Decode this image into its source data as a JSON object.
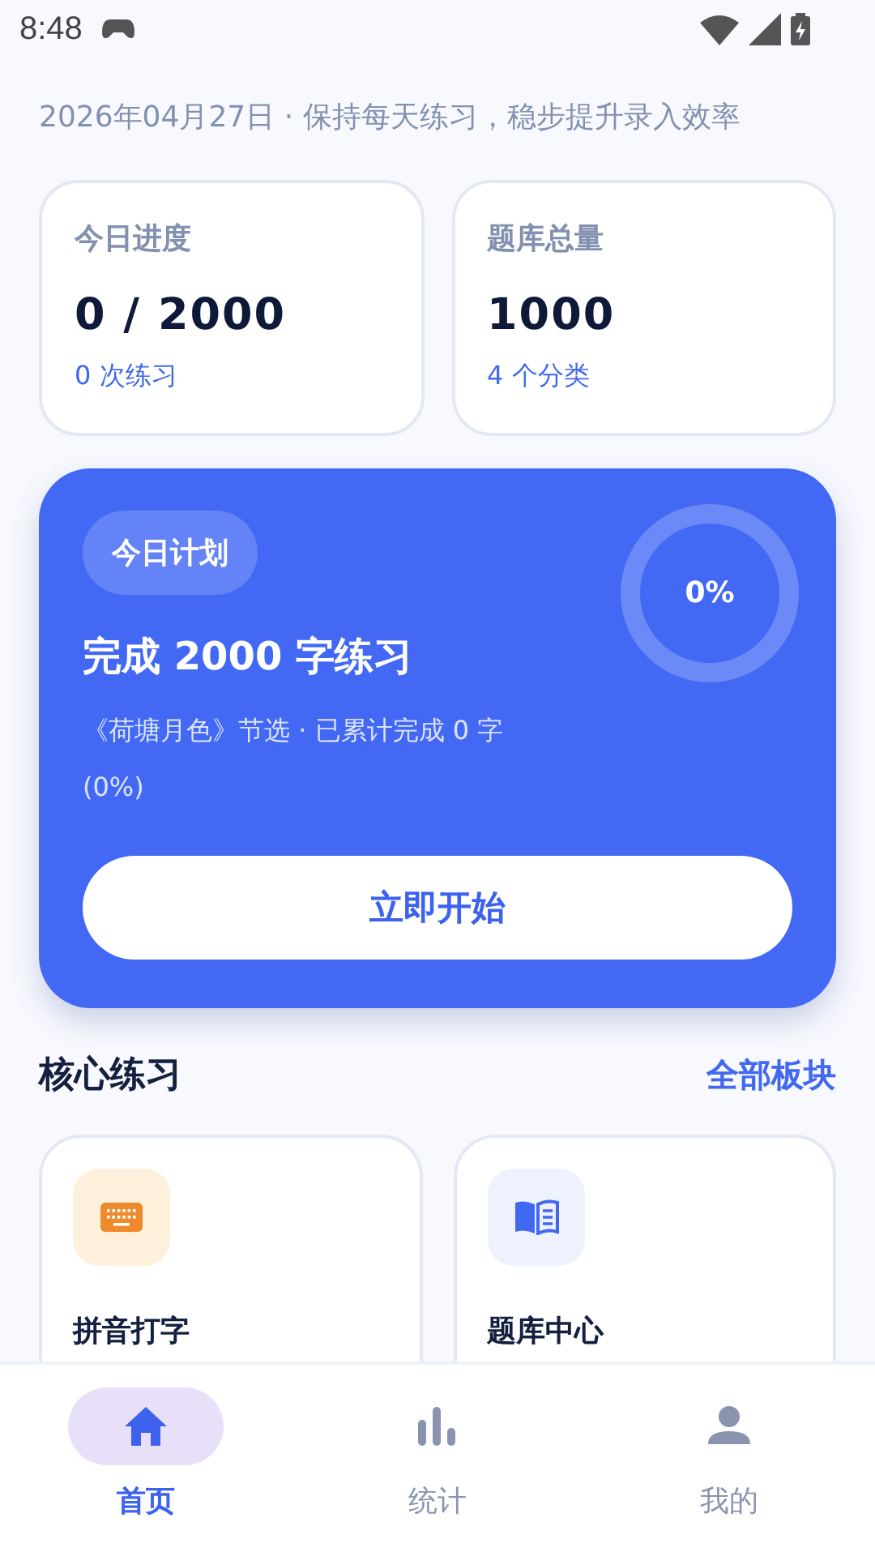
{
  "status_bar": {
    "time": "8:48"
  },
  "subtitle": "2026年04月27日 · 保持每天练习，稳步提升录入效率",
  "stats": [
    {
      "label": "今日进度",
      "value": "0 / 2000",
      "note": "0 次练习"
    },
    {
      "label": "题库总量",
      "value": "1000",
      "note": "4 个分类"
    }
  ],
  "plan": {
    "badge": "今日计划",
    "title": "完成 2000 字练习",
    "description": "《荷塘月色》节选 · 已累计完成 0 字",
    "percent_note": "(0%)",
    "progress": {
      "reading": "0%"
    },
    "button": "立即开始"
  },
  "section": {
    "title": "核心练习",
    "link": "全部板块"
  },
  "features": [
    {
      "kind": "keyboard",
      "label": "拼音打字"
    },
    {
      "kind": "book",
      "label": "题库中心"
    }
  ],
  "bottom_nav": [
    {
      "kind": "home",
      "label": "首页",
      "selected": true
    },
    {
      "kind": "stats",
      "label": "统计",
      "selected": false
    },
    {
      "kind": "profile",
      "label": "我的",
      "selected": false
    }
  ]
}
